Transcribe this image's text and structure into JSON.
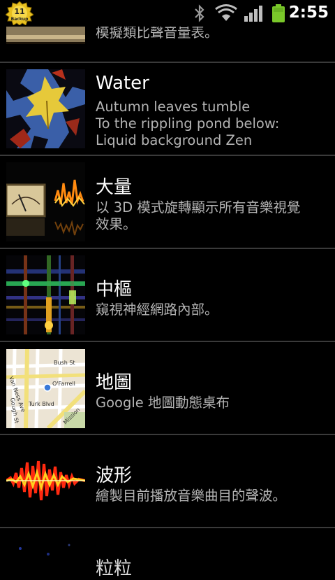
{
  "status_bar": {
    "backup_badge_label": "Backup",
    "backup_number": "11",
    "time": "2:55",
    "icons": [
      "backup-app-icon",
      "bluetooth-icon",
      "wifi-icon",
      "signal-icon",
      "battery-icon"
    ]
  },
  "list": {
    "partial_top_desc": "模擬類比聲音量表。",
    "items": [
      {
        "title": "Water",
        "description": [
          "Autumn leaves tumble",
          "To the rippling pond below:",
          "Liquid background Zen"
        ],
        "thumbnail": "autumn-leaves-thumbnail"
      },
      {
        "title": "大量",
        "description": [
          "以 3D 模式旋轉顯示所有音樂視覺",
          "效果。"
        ],
        "thumbnail": "vu-meter-waveform-thumbnail"
      },
      {
        "title": "中樞",
        "description": [
          "窺視神經網路內部。"
        ],
        "thumbnail": "neural-grid-thumbnail"
      },
      {
        "title": "地圖",
        "description": [
          "Google 地圖動態桌布"
        ],
        "thumbnail": "street-map-thumbnail",
        "map_labels": [
          "Bush St",
          "Van Ness Ave",
          "O'Farrell",
          "Gough St",
          "Turk Blvd",
          "Mission"
        ]
      },
      {
        "title": "波形",
        "description": [
          "繪製目前播放音樂曲目的聲波。"
        ],
        "thumbnail": "sound-wave-thumbnail"
      }
    ],
    "partial_bottom_title": "粒粒"
  }
}
